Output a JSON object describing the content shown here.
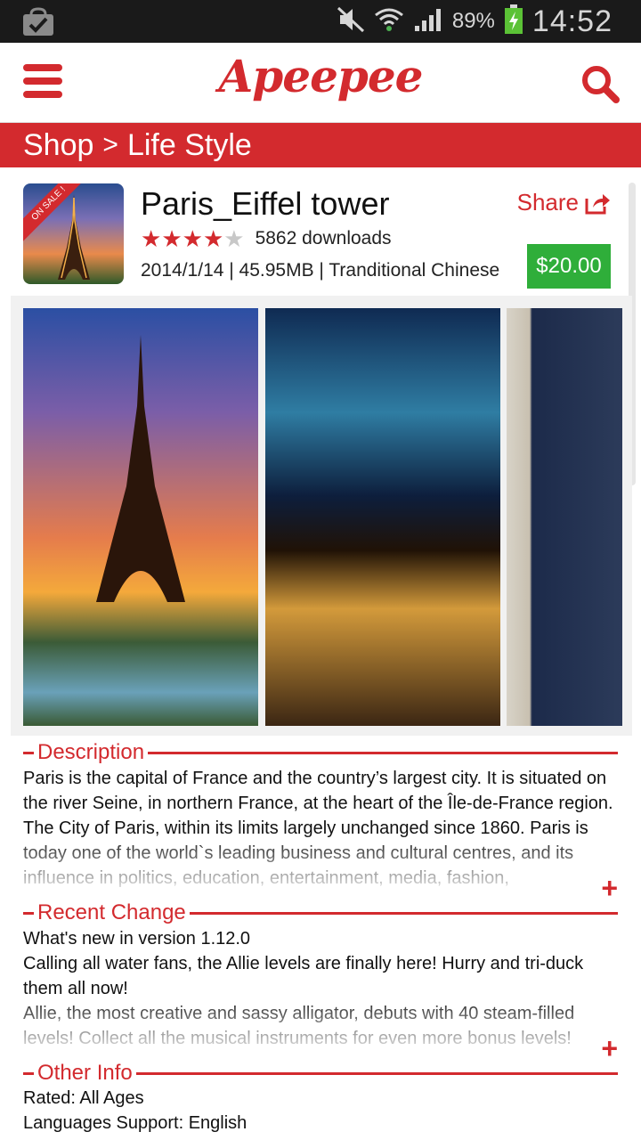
{
  "status": {
    "battery": "89%",
    "time": "14:52"
  },
  "app": {
    "logo": "Apeepee"
  },
  "breadcrumb": {
    "root": "Shop",
    "separator": ">",
    "current": "Life Style"
  },
  "item": {
    "badge": "ON SALE !",
    "title": "Paris_Eiffel tower",
    "rating": 4,
    "rating_max": 5,
    "downloads": "5862 downloads",
    "meta": "2014/1/14 | 45.95MB | Tranditional Chinese",
    "share_label": "Share",
    "price": "$20.00"
  },
  "description": {
    "heading": "Description",
    "text": "Paris is the capital of France and the country’s largest city. It is situated on the river Seine, in northern France, at the heart of the Île-de-France region. The City of Paris, within its limits largely unchanged since 1860. Paris is today one of the world`s leading business and cultural centres, and its influence in politics, education, entertainment, media, fashion,"
  },
  "recent_change": {
    "heading": "Recent Change",
    "lines": [
      "What's new in version 1.12.0",
      "Calling all water fans, the Allie levels are finally here! Hurry and tri-duck them all now!",
      "Allie, the most creative and sassy alligator, debuts with 40 steam-filled levels! Collect all the musical instruments for even more bonus levels!"
    ]
  },
  "other_info": {
    "heading": "Other Info",
    "rated": "Rated: All Ages",
    "languages": "Languages Support: English"
  },
  "colors": {
    "accent": "#d32a2e",
    "price_bg": "#2fae3a"
  }
}
